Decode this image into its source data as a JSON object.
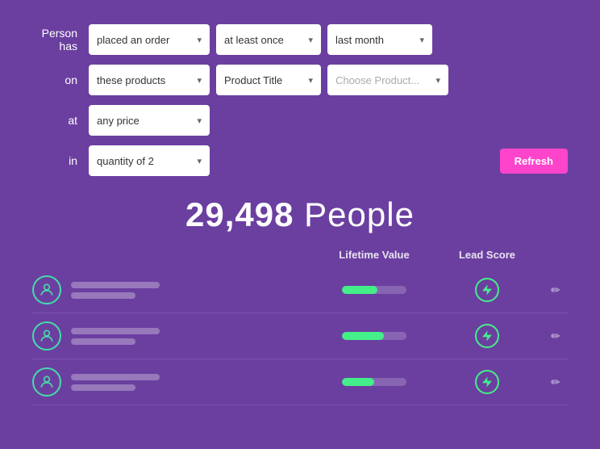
{
  "filter": {
    "person_label": "Person has",
    "on_label": "on",
    "at_label": "at",
    "in_label": "in",
    "row1": {
      "option1": "placed an order",
      "option2": "at least once",
      "option3": "last month"
    },
    "row2": {
      "option1": "these products",
      "option2": "Product Title",
      "option3_placeholder": "Choose Product..."
    },
    "row3": {
      "option1": "any price"
    },
    "row4": {
      "option1": "quantity of 2"
    },
    "refresh_label": "Refresh"
  },
  "results": {
    "count": "29,498",
    "people_label": "People"
  },
  "table": {
    "headers": {
      "lifetime_value": "Lifetime Value",
      "lead_score": "Lead Score"
    }
  },
  "people": [
    {
      "progress": 55
    },
    {
      "progress": 65
    },
    {
      "progress": 50
    }
  ]
}
